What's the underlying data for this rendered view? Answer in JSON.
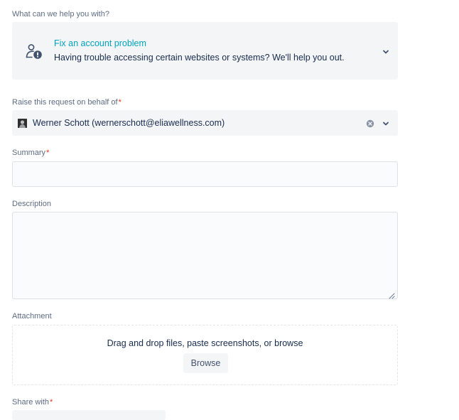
{
  "request_type": {
    "label": "What can we help you with?",
    "title": "Fix an account problem",
    "description": "Having trouble accessing certain websites or systems? We'll help you out.",
    "icon": "person-alert-icon"
  },
  "on_behalf": {
    "label": "Raise this request on behalf of",
    "required_mark": "*",
    "value": "Werner Schott (wernerschott@eliawellness.com)"
  },
  "summary": {
    "label": "Summary",
    "required_mark": "*",
    "value": ""
  },
  "description": {
    "label": "Description",
    "value": ""
  },
  "attachment": {
    "label": "Attachment",
    "hint": "Drag and drop files, paste screenshots, or browse",
    "browse_label": "Browse"
  },
  "share_with": {
    "label": "Share with",
    "required_mark": "*"
  },
  "colors": {
    "accent_teal": "#00a3bf",
    "required_red": "#de350b",
    "label_gray": "#5e6c84",
    "field_bg": "#f4f5f7"
  }
}
